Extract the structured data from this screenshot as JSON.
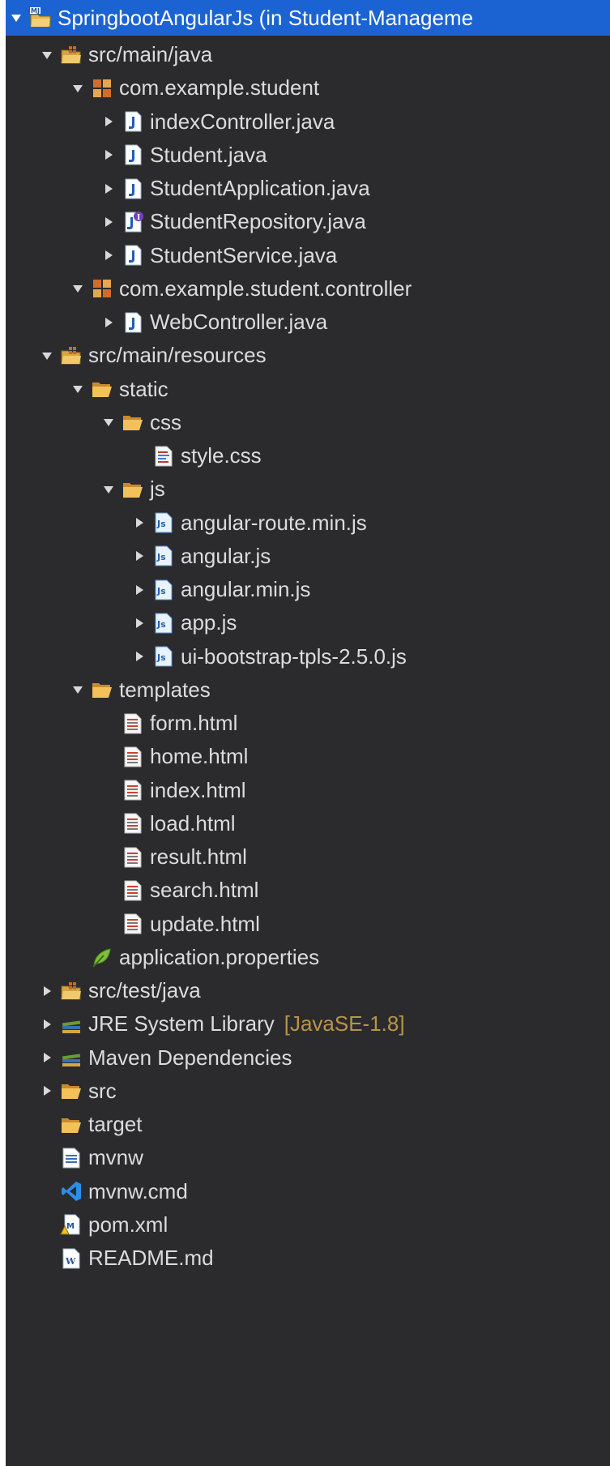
{
  "project": {
    "label": "SpringbootAngularJs (in Student-Manageme"
  },
  "nodes": [
    {
      "key": "src-main-java",
      "label": "src/main/java",
      "icon": "package-folder-icon",
      "expanded": true
    },
    {
      "key": "pkg-student",
      "label": "com.example.student",
      "icon": "package-icon",
      "expanded": true
    },
    {
      "key": "indexcontroller",
      "label": "indexController.java",
      "icon": "java-file-icon",
      "expanded": false
    },
    {
      "key": "student",
      "label": "Student.java",
      "icon": "java-file-icon",
      "expanded": false
    },
    {
      "key": "studentapplication",
      "label": "StudentApplication.java",
      "icon": "java-file-icon",
      "expanded": false
    },
    {
      "key": "studentrepository",
      "label": "StudentRepository.java",
      "icon": "java-interface-file-icon",
      "expanded": false
    },
    {
      "key": "studentservice",
      "label": "StudentService.java",
      "icon": "java-file-icon",
      "expanded": false
    },
    {
      "key": "pkg-controller",
      "label": "com.example.student.controller",
      "icon": "package-icon",
      "expanded": true
    },
    {
      "key": "webcontroller",
      "label": "WebController.java",
      "icon": "java-file-icon",
      "expanded": false
    },
    {
      "key": "src-main-resources",
      "label": "src/main/resources",
      "icon": "package-folder-icon",
      "expanded": true
    },
    {
      "key": "static",
      "label": "static",
      "icon": "folder-open-icon",
      "expanded": true
    },
    {
      "key": "css",
      "label": "css",
      "icon": "folder-open-icon",
      "expanded": true
    },
    {
      "key": "style-css",
      "label": "style.css",
      "icon": "css-file-icon",
      "expanded": null
    },
    {
      "key": "js",
      "label": "js",
      "icon": "folder-open-icon",
      "expanded": true
    },
    {
      "key": "angular-route",
      "label": "angular-route.min.js",
      "icon": "js-file-icon",
      "expanded": false
    },
    {
      "key": "angular-js",
      "label": "angular.js",
      "icon": "js-file-icon",
      "expanded": false
    },
    {
      "key": "angular-min",
      "label": "angular.min.js",
      "icon": "js-file-icon",
      "expanded": false
    },
    {
      "key": "app-js",
      "label": "app.js",
      "icon": "js-file-icon",
      "expanded": false
    },
    {
      "key": "ui-bootstrap",
      "label": "ui-bootstrap-tpls-2.5.0.js",
      "icon": "js-file-icon",
      "expanded": false
    },
    {
      "key": "templates",
      "label": "templates",
      "icon": "folder-open-icon",
      "expanded": true
    },
    {
      "key": "form-html",
      "label": "form.html",
      "icon": "html-file-icon",
      "expanded": null
    },
    {
      "key": "home-html",
      "label": "home.html",
      "icon": "html-file-icon",
      "expanded": null
    },
    {
      "key": "index-html",
      "label": "index.html",
      "icon": "html-file-icon",
      "expanded": null
    },
    {
      "key": "load-html",
      "label": "load.html",
      "icon": "html-file-icon",
      "expanded": null
    },
    {
      "key": "result-html",
      "label": "result.html",
      "icon": "html-file-icon",
      "expanded": null
    },
    {
      "key": "search-html",
      "label": "search.html",
      "icon": "html-file-icon",
      "expanded": null
    },
    {
      "key": "update-html",
      "label": "update.html",
      "icon": "html-file-icon",
      "expanded": null
    },
    {
      "key": "application-properties",
      "label": "application.properties",
      "icon": "properties-file-icon",
      "expanded": null
    },
    {
      "key": "src-test-java",
      "label": "src/test/java",
      "icon": "package-folder-icon",
      "expanded": false
    },
    {
      "key": "jre",
      "label": "JRE System Library",
      "decoration": "[JavaSE-1.8]",
      "icon": "library-icon",
      "expanded": false
    },
    {
      "key": "maven-deps",
      "label": "Maven Dependencies",
      "icon": "library-icon",
      "expanded": false
    },
    {
      "key": "src",
      "label": "src",
      "icon": "folder-open-icon",
      "expanded": false
    },
    {
      "key": "target",
      "label": "target",
      "icon": "folder-open-icon",
      "expanded": null
    },
    {
      "key": "mvnw",
      "label": "mvnw",
      "icon": "text-file-icon",
      "expanded": null
    },
    {
      "key": "mvnw-cmd",
      "label": "mvnw.cmd",
      "icon": "vscode-file-icon",
      "expanded": null
    },
    {
      "key": "pom-xml",
      "label": "pom.xml",
      "icon": "maven-pom-icon",
      "expanded": null
    },
    {
      "key": "readme",
      "label": "README.md",
      "icon": "word-file-icon",
      "expanded": null
    }
  ],
  "colors": {
    "panel_background": "#2b2b2d",
    "selection": "#1b63d3",
    "text": "#dcdcdc",
    "decoration": "#b8944a"
  }
}
